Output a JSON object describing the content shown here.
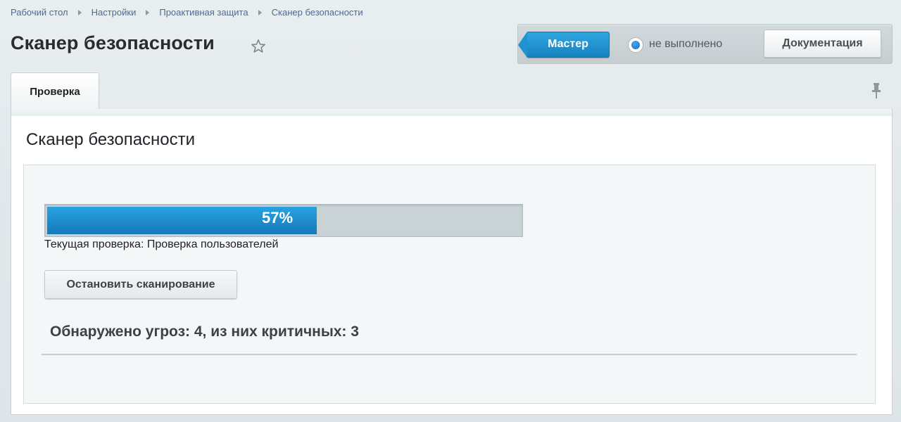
{
  "breadcrumb": [
    "Рабочий стол",
    "Настройки",
    "Проактивная защита",
    "Сканер безопасности"
  ],
  "page_title": "Сканер безопасности",
  "header": {
    "master_label": "Мастер",
    "status_text": "не выполнено",
    "doc_label": "Документация"
  },
  "tabs": [
    {
      "label": "Проверка"
    }
  ],
  "main": {
    "section_title": "Сканер безопасности",
    "progress": {
      "percent": 57,
      "label": "57%"
    },
    "current_check": "Текущая проверка: Проверка пользователей",
    "stop_label": "Остановить сканирование",
    "threats_summary": "Обнаружено угроз: 4, из них критичных: 3"
  },
  "colors": {
    "accent": "#1e93d0",
    "link": "#4b6a93"
  },
  "icons": {
    "favorite": "star-icon",
    "pin": "pin-icon",
    "status": "radio-dot-icon"
  }
}
